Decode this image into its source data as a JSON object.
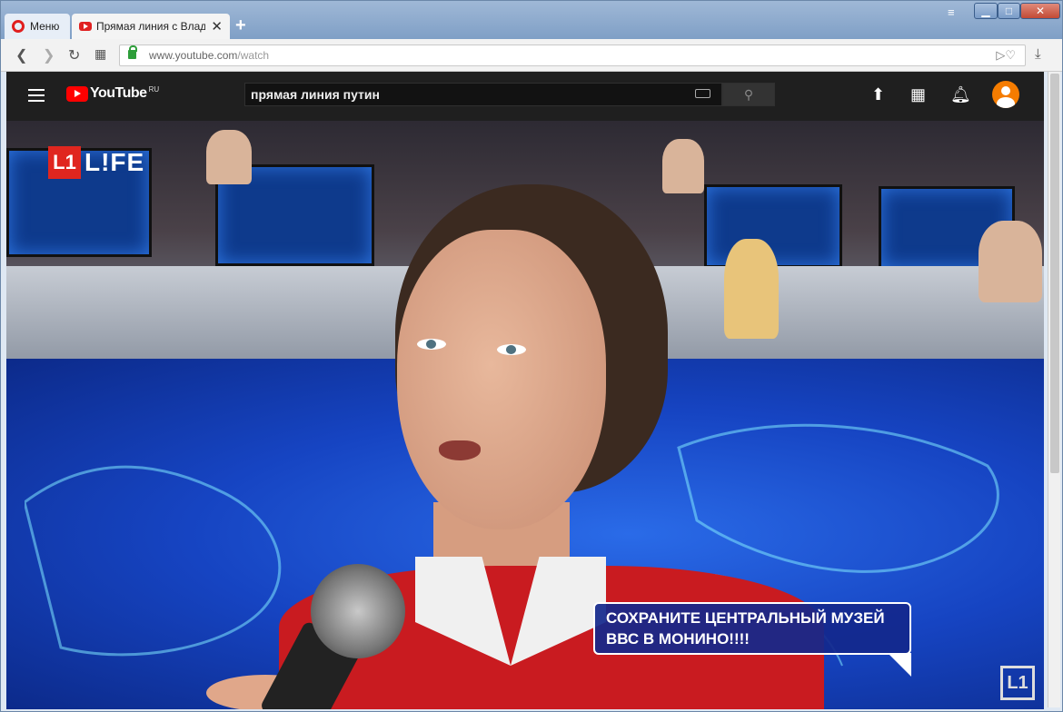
{
  "browser": {
    "menu_label": "Меню",
    "tab_title": "Прямая линия с Владими",
    "tab_close": "✕",
    "new_tab": "+",
    "url_host": "www.youtube.com",
    "url_path": "/watch"
  },
  "youtube": {
    "logo_text": "YouTube",
    "logo_country": "RU",
    "search_value": "прямая линия путин"
  },
  "video": {
    "channel_logo": "L!FE",
    "caption_line1": "СОХРАНИТЕ ЦЕНТРАЛЬНЫЙ МУЗЕЙ",
    "caption_line2": "ВВС В МОНИНО!!!!"
  }
}
